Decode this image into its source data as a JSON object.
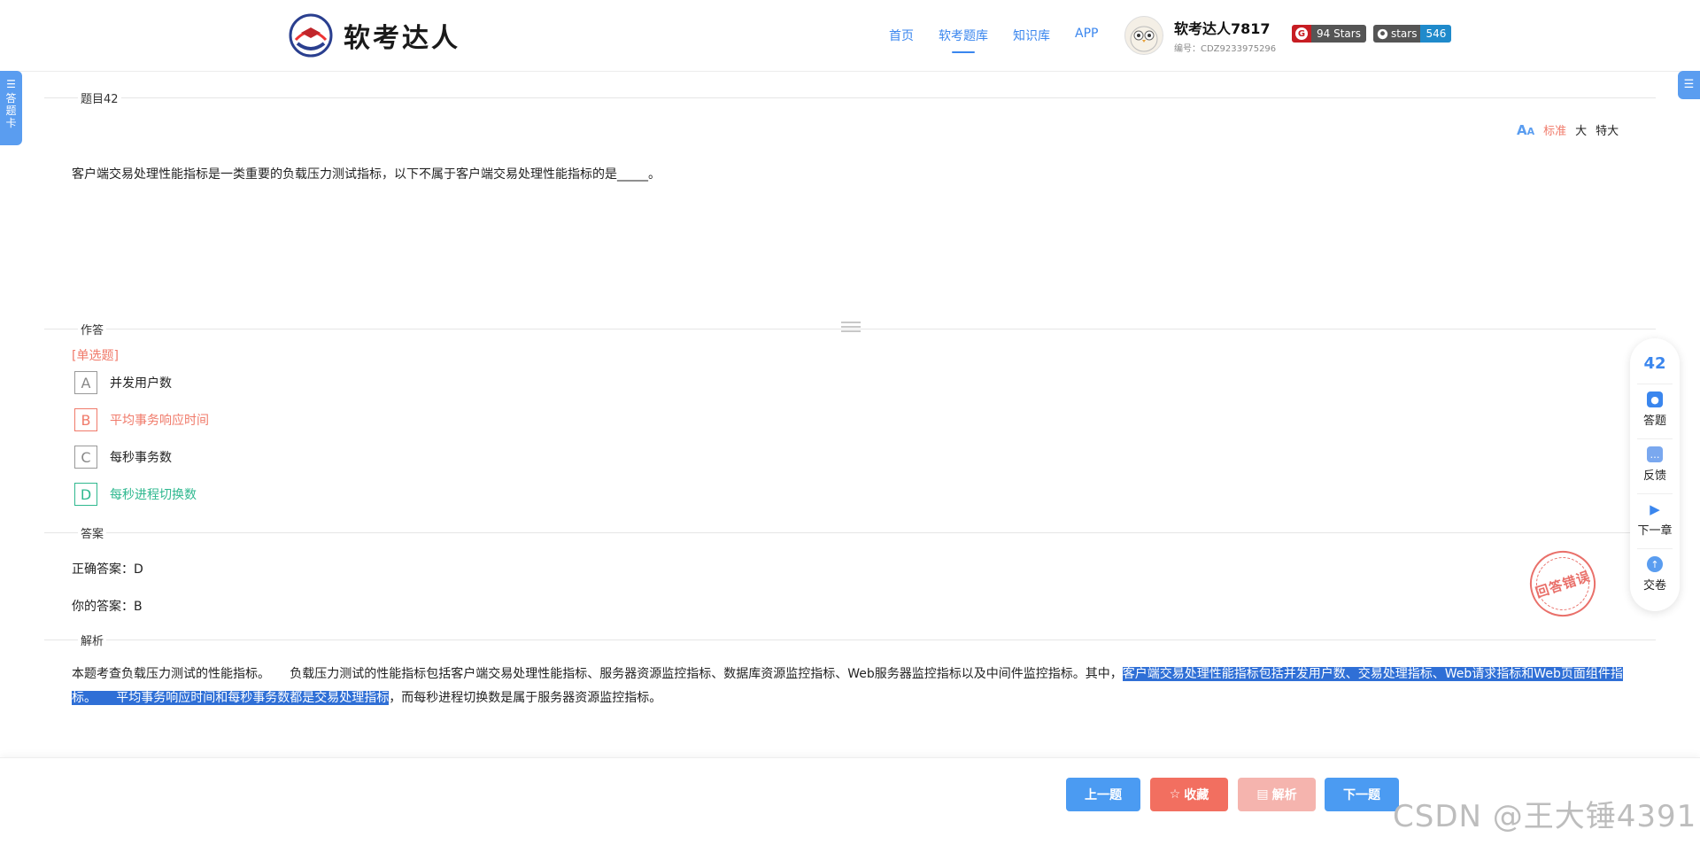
{
  "header": {
    "logo_text": "软考达人",
    "nav": [
      "首页",
      "软考题库",
      "知识库",
      "APP"
    ],
    "nav_active": "软考题库",
    "user_name": "软考达人7817",
    "user_id": "编号：CDZ9233975296",
    "badge_gitee": "94 Stars",
    "badge_github_label": "stars",
    "badge_github_count": "546"
  },
  "side": {
    "card_tab": "答题卡"
  },
  "question": {
    "section_label": "题目42",
    "font_sizes": [
      "标准",
      "大",
      "特大"
    ],
    "font_size_active": "标准",
    "text": "客户端交易处理性能指标是一类重要的负载压力测试指标，以下不属于客户端交易处理性能指标的是_____。"
  },
  "answer_section": {
    "section_label": "作答",
    "type_label": "[单选题]",
    "options": [
      {
        "letter": "A",
        "text": "并发用户数",
        "state": "normal"
      },
      {
        "letter": "B",
        "text": "平均事务响应时间",
        "state": "wrong"
      },
      {
        "letter": "C",
        "text": "每秒事务数",
        "state": "normal"
      },
      {
        "letter": "D",
        "text": "每秒进程切换数",
        "state": "correct"
      }
    ]
  },
  "result": {
    "section_label": "答案",
    "correct": "正确答案：D",
    "yours": "你的答案：B",
    "stamp": "回答错误"
  },
  "analysis": {
    "section_label": "解析",
    "part1": "本题考查负载压力测试的性能指标。     负载压力测试的性能指标包括客户端交易处理性能指标、服务器资源监控指标、数据库资源监控指标、Web服务器监控指标以及中间件监控指标。其中，",
    "highlight": "客户端交易处理性能指标包括并发用户数、交易处理指标、Web请求指标和Web页面组件指标。     平均事务响应时间和每秒事务数都是交易处理指标",
    "part2": "，而每秒进程切换数是属于服务器资源监控指标。"
  },
  "float_bar": {
    "number": "42",
    "items": [
      "答题",
      "反馈",
      "下一章",
      "交卷"
    ]
  },
  "bottom": {
    "prev": "上一题",
    "fav": "收藏",
    "analysis": "解析",
    "next": "下一题",
    "watermark": "CSDN @王大锤4391"
  },
  "colors": {
    "primary": "#3a86ee",
    "wrong": "#f07a6a",
    "correct": "#2fb88f",
    "highlight": "#2f6fd6"
  }
}
